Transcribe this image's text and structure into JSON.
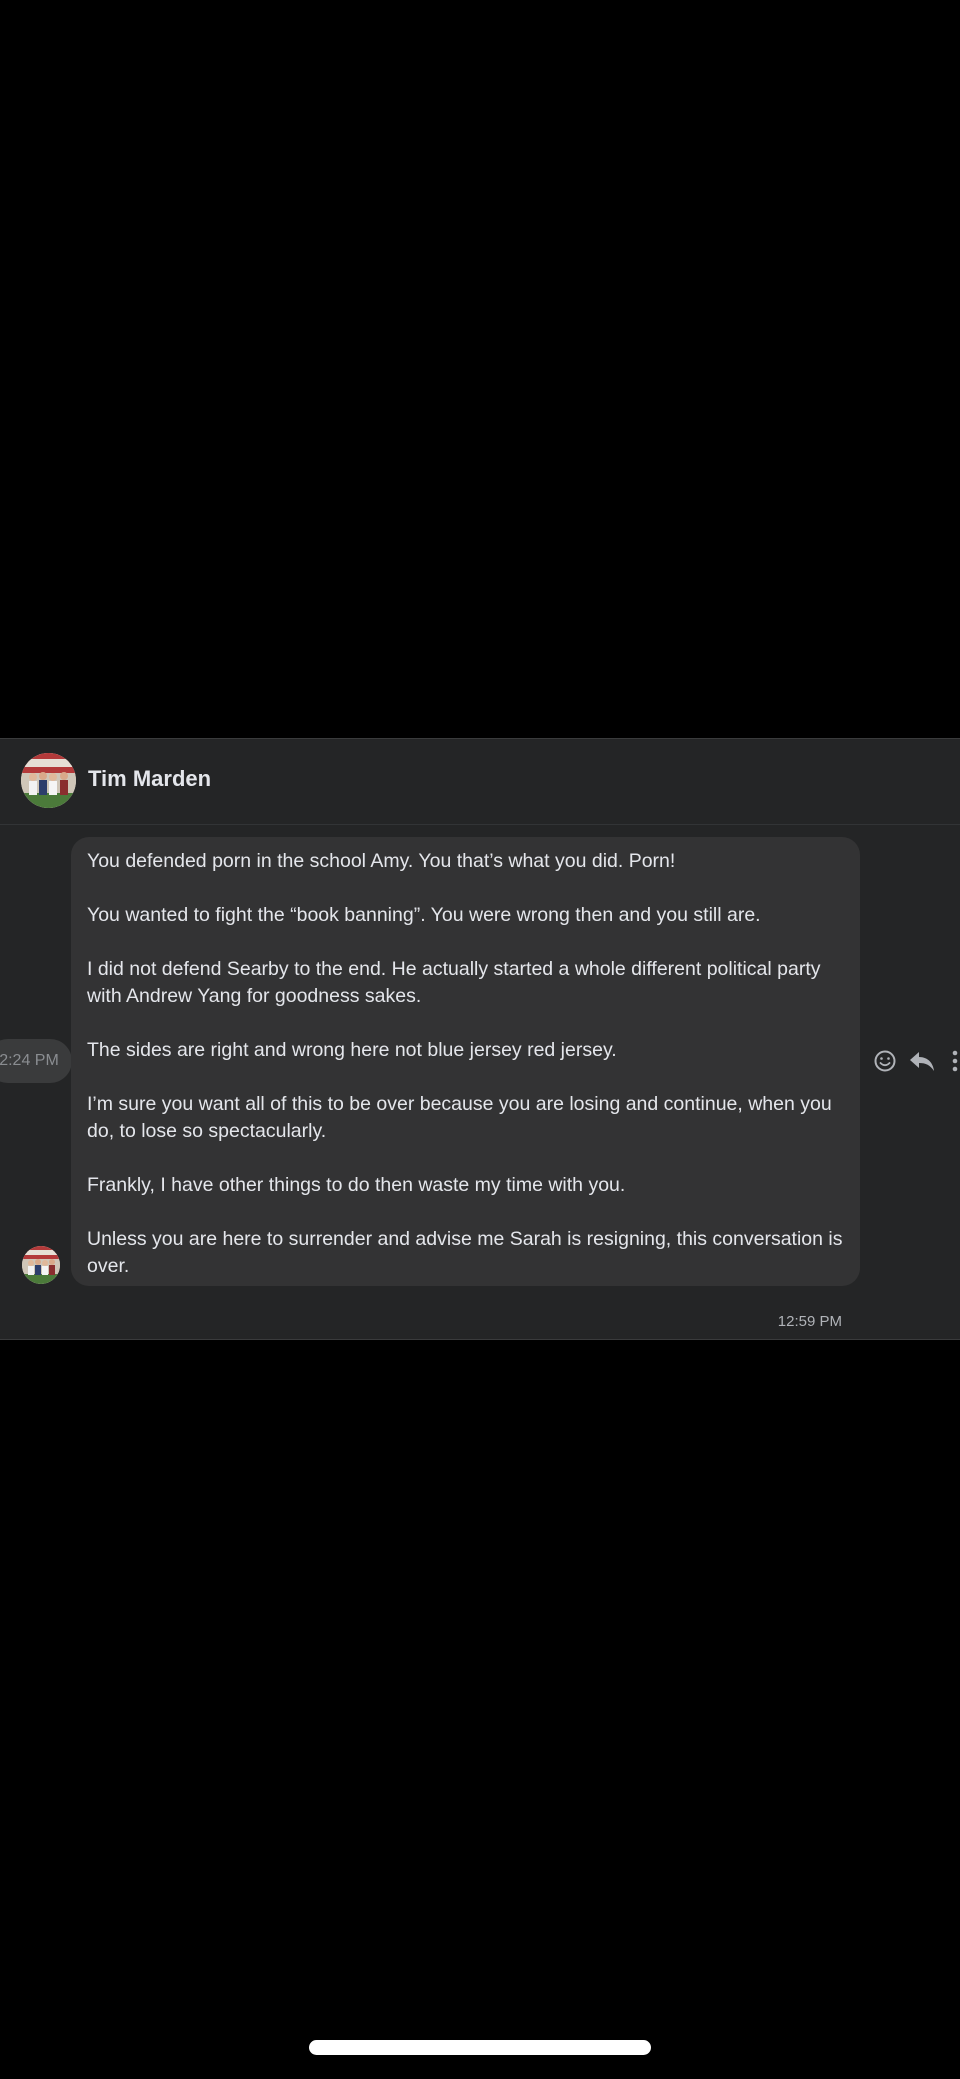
{
  "header": {
    "contact_name": "Tim Marden"
  },
  "previous_message": {
    "time": "2:24 PM"
  },
  "message": {
    "paragraphs": [
      "You defended porn in the school Amy. You that’s what you did. Porn!",
      "You wanted to fight the “book banning”. You were wrong then and you still are.",
      "I did not defend Searby to the end. He actually started a whole different political party with Andrew Yang for goodness sakes.",
      "The sides are right and wrong here not blue jersey red jersey.",
      "I’m sure you want all of this to be over because you are losing and continue, when you do, to lose so spectacularly.",
      "Frankly, I have other things to do then waste my time with you.",
      "Unless you are here to surrender and advise me Sarah is resigning, this conversation is over."
    ],
    "time": "12:59 PM"
  },
  "actions": {
    "icons": [
      "smiley-react-icon",
      "reply-arrow-icon",
      "more-options-icon"
    ]
  },
  "colors": {
    "page_background": "#000000",
    "panel_background": "#242526",
    "bubble_background": "#333334",
    "text_primary": "#e4e6eb",
    "text_secondary": "#b0b3b8"
  }
}
